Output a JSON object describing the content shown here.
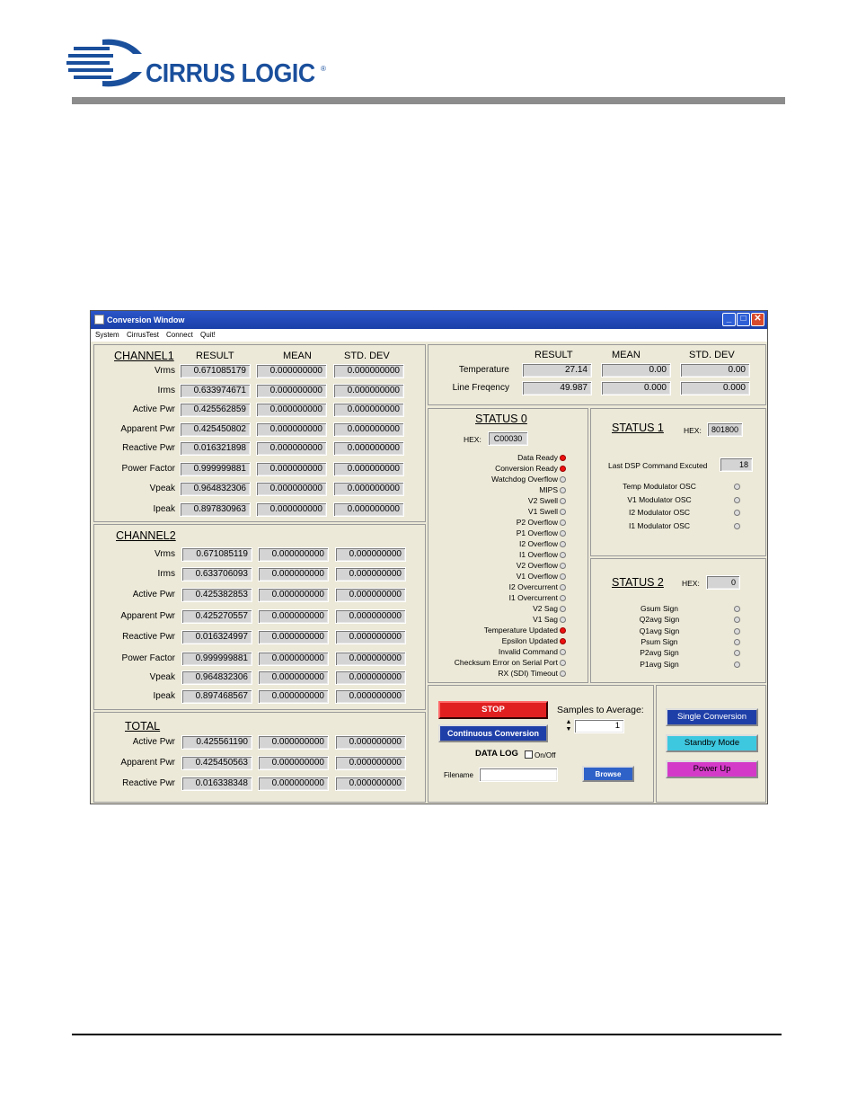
{
  "brand": {
    "name": "CIRRUS LOGIC",
    "reg": "®"
  },
  "window": {
    "title": "Conversion Window"
  },
  "menu": [
    "System",
    "CirrusTest",
    "Connect",
    "Quit!"
  ],
  "columns": {
    "result": "RESULT",
    "mean": "MEAN",
    "std": "STD. DEV"
  },
  "channel1": {
    "title": "CHANNEL1",
    "rows": [
      {
        "label": "Vrms",
        "result": "0.671085179",
        "mean": "0.000000000",
        "std": "0.000000000"
      },
      {
        "label": "Irms",
        "result": "0.633974671",
        "mean": "0.000000000",
        "std": "0.000000000"
      },
      {
        "label": "Active Pwr",
        "result": "0.425562859",
        "mean": "0.000000000",
        "std": "0.000000000"
      },
      {
        "label": "Apparent Pwr",
        "result": "0.425450802",
        "mean": "0.000000000",
        "std": "0.000000000"
      },
      {
        "label": "Reactive Pwr",
        "result": "0.016321898",
        "mean": "0.000000000",
        "std": "0.000000000"
      },
      {
        "label": "Power Factor",
        "result": "0.999999881",
        "mean": "0.000000000",
        "std": "0.000000000"
      },
      {
        "label": "Vpeak",
        "result": "0.964832306",
        "mean": "0.000000000",
        "std": "0.000000000"
      },
      {
        "label": "Ipeak",
        "result": "0.897830963",
        "mean": "0.000000000",
        "std": "0.000000000"
      }
    ]
  },
  "channel2": {
    "title": "CHANNEL2",
    "rows": [
      {
        "label": "Vrms",
        "result": "0.671085119",
        "mean": "0.000000000",
        "std": "0.000000000"
      },
      {
        "label": "Irms",
        "result": "0.633706093",
        "mean": "0.000000000",
        "std": "0.000000000"
      },
      {
        "label": "Active Pwr",
        "result": "0.425382853",
        "mean": "0.000000000",
        "std": "0.000000000"
      },
      {
        "label": "Apparent Pwr",
        "result": "0.425270557",
        "mean": "0.000000000",
        "std": "0.000000000"
      },
      {
        "label": "Reactive Pwr",
        "result": "0.016324997",
        "mean": "0.000000000",
        "std": "0.000000000"
      },
      {
        "label": "Power Factor",
        "result": "0.999999881",
        "mean": "0.000000000",
        "std": "0.000000000"
      },
      {
        "label": "Vpeak",
        "result": "0.964832306",
        "mean": "0.000000000",
        "std": "0.000000000"
      },
      {
        "label": "Ipeak",
        "result": "0.897468567",
        "mean": "0.000000000",
        "std": "0.000000000"
      }
    ]
  },
  "total": {
    "title": "TOTAL",
    "rows": [
      {
        "label": "Active Pwr",
        "result": "0.425561190",
        "mean": "0.000000000",
        "std": "0.000000000"
      },
      {
        "label": "Apparent Pwr",
        "result": "0.425450563",
        "mean": "0.000000000",
        "std": "0.000000000"
      },
      {
        "label": "Reactive Pwr",
        "result": "0.016338348",
        "mean": "0.000000000",
        "std": "0.000000000"
      }
    ]
  },
  "misc": {
    "rows": [
      {
        "label": "Temperature",
        "result": "27.14",
        "mean": "0.00",
        "std": "0.00"
      },
      {
        "label": "Line Freqency",
        "result": "49.987",
        "mean": "0.000",
        "std": "0.000"
      }
    ]
  },
  "status0": {
    "title": "STATUS 0",
    "hex_label": "HEX:",
    "hex": "C00030",
    "items": [
      {
        "label": "Data Ready",
        "on": true
      },
      {
        "label": "Conversion Ready",
        "on": true
      },
      {
        "label": "Watchdog Overflow",
        "on": false
      },
      {
        "label": "MIPS",
        "on": false
      },
      {
        "label": "V2 Swell",
        "on": false
      },
      {
        "label": "V1 Swell",
        "on": false
      },
      {
        "label": "P2 Overflow",
        "on": false
      },
      {
        "label": "P1 Overflow",
        "on": false
      },
      {
        "label": "I2 Overflow",
        "on": false
      },
      {
        "label": "I1 Overflow",
        "on": false
      },
      {
        "label": "V2 Overflow",
        "on": false
      },
      {
        "label": "V1 Overflow",
        "on": false
      },
      {
        "label": "I2 Overcurrent",
        "on": false
      },
      {
        "label": "I1 Overcurrent",
        "on": false
      },
      {
        "label": "V2 Sag",
        "on": false
      },
      {
        "label": "V1 Sag",
        "on": false
      },
      {
        "label": "Temperature Updated",
        "on": true
      },
      {
        "label": "Epsilon Updated",
        "on": true
      },
      {
        "label": "Invalid Command",
        "on": false
      },
      {
        "label": "Checksum Error on Serial Port",
        "on": false
      },
      {
        "label": "RX (SDI) Timeout",
        "on": false
      }
    ]
  },
  "status1": {
    "title": "STATUS 1",
    "hex_label": "HEX:",
    "hex": "801800",
    "last_dsp_label": "Last DSP Command Excuted",
    "last_dsp": "18",
    "items": [
      {
        "label": "Temp Modulator OSC",
        "on": false
      },
      {
        "label": "V1 Modulator OSC",
        "on": false
      },
      {
        "label": "I2 Modulator OSC",
        "on": false
      },
      {
        "label": "I1 Modulator OSC",
        "on": false
      }
    ]
  },
  "status2": {
    "title": "STATUS 2",
    "hex_label": "HEX:",
    "hex": "0",
    "items": [
      {
        "label": "Gsum Sign",
        "on": false
      },
      {
        "label": "Q2avg Sign",
        "on": false
      },
      {
        "label": "Q1avg Sign",
        "on": false
      },
      {
        "label": "Psum Sign",
        "on": false
      },
      {
        "label": "P2avg Sign",
        "on": false
      },
      {
        "label": "P1avg Sign",
        "on": false
      }
    ]
  },
  "controls": {
    "stop": "STOP",
    "continuous": "Continuous Conversion",
    "samples_label": "Samples to Average:",
    "samples": "1",
    "datalog_label": "DATA LOG",
    "onoff": "On/Off",
    "filename_label": "Filename",
    "filename": "",
    "browse": "Browse",
    "single": "Single Conversion",
    "standby": "Standby Mode",
    "powerup": "Power Up"
  },
  "colors": {
    "brand": "#1a4f9c",
    "stop": "#e02020",
    "blue_btn": "#1f3fa8",
    "cyan_btn": "#3ec8e0",
    "magenta_btn": "#d43ac8"
  }
}
